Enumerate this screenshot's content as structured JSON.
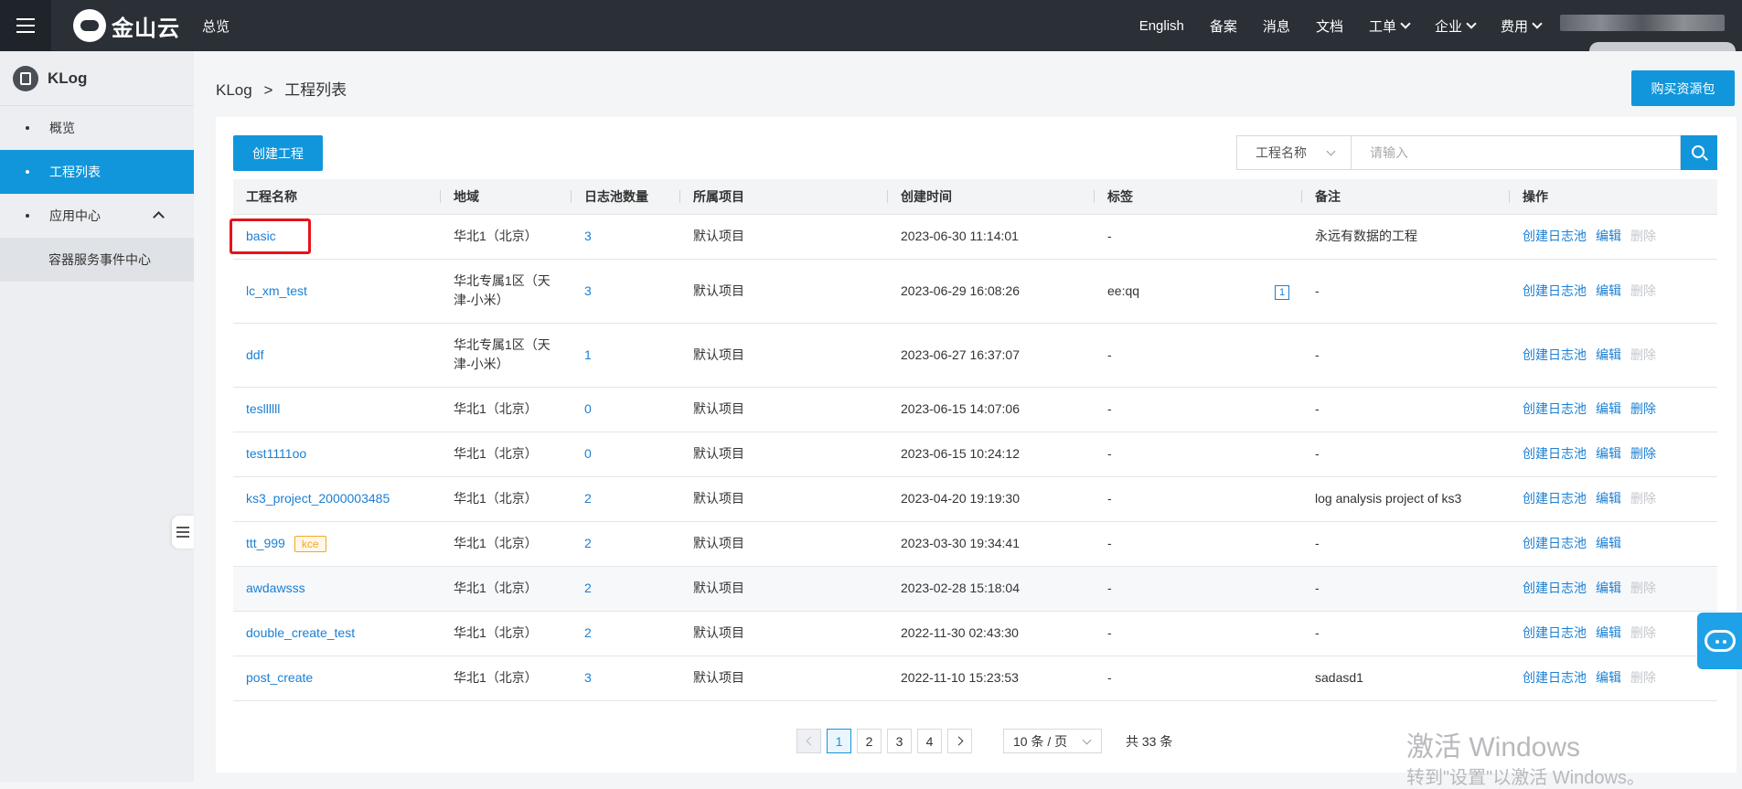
{
  "header": {
    "logo_text": "金山云",
    "overview": "总览",
    "nav": [
      "English",
      "备案",
      "消息",
      "文档"
    ],
    "dropdowns": [
      "工单",
      "企业",
      "费用"
    ]
  },
  "sidebar": {
    "product": "KLog",
    "items": [
      {
        "label": "概览"
      },
      {
        "label": "工程列表"
      },
      {
        "label": "应用中心"
      }
    ],
    "sub_item": "容器服务事件中心"
  },
  "breadcrumb": {
    "root": "KLog",
    "sep": ">",
    "current": "工程列表"
  },
  "toolbar": {
    "buy_label": "购买资源包",
    "create_label": "创建工程",
    "filter_selected": "工程名称",
    "search_placeholder": "请输入"
  },
  "table": {
    "columns": [
      "工程名称",
      "地域",
      "日志池数量",
      "所属项目",
      "创建时间",
      "标签",
      "备注",
      "操作"
    ],
    "actions": {
      "create_pool": "创建日志池",
      "edit": "编辑",
      "delete": "删除"
    },
    "rows": [
      {
        "name": "basic",
        "region": "华北1（北京）",
        "pools": "3",
        "project": "默认项目",
        "created": "2023-06-30 11:14:01",
        "tag": "-",
        "tag_count": "",
        "badge": "",
        "note": "永远有数据的工程",
        "delete_enabled": false,
        "show_delete": true
      },
      {
        "name": "lc_xm_test",
        "region": "华北专属1区（天津-小米）",
        "pools": "3",
        "project": "默认项目",
        "created": "2023-06-29 16:08:26",
        "tag": "ee:qq",
        "tag_count": "1",
        "badge": "",
        "note": "-",
        "delete_enabled": false,
        "show_delete": true
      },
      {
        "name": "ddf",
        "region": "华北专属1区（天津-小米）",
        "pools": "1",
        "project": "默认项目",
        "created": "2023-06-27 16:37:07",
        "tag": "-",
        "tag_count": "",
        "badge": "",
        "note": "-",
        "delete_enabled": false,
        "show_delete": true
      },
      {
        "name": "tesllllll",
        "region": "华北1（北京）",
        "pools": "0",
        "project": "默认项目",
        "created": "2023-06-15 14:07:06",
        "tag": "-",
        "tag_count": "",
        "badge": "",
        "note": "-",
        "delete_enabled": true,
        "show_delete": true
      },
      {
        "name": "test1111oo",
        "region": "华北1（北京）",
        "pools": "0",
        "project": "默认项目",
        "created": "2023-06-15 10:24:12",
        "tag": "-",
        "tag_count": "",
        "badge": "",
        "note": "-",
        "delete_enabled": true,
        "show_delete": true
      },
      {
        "name": "ks3_project_2000003485",
        "region": "华北1（北京）",
        "pools": "2",
        "project": "默认项目",
        "created": "2023-04-20 19:19:30",
        "tag": "-",
        "tag_count": "",
        "badge": "",
        "note": "log analysis project of ks3",
        "delete_enabled": false,
        "show_delete": true
      },
      {
        "name": "ttt_999",
        "region": "华北1（北京）",
        "pools": "2",
        "project": "默认项目",
        "created": "2023-03-30 19:34:41",
        "tag": "-",
        "tag_count": "",
        "badge": "kce",
        "note": "-",
        "delete_enabled": false,
        "show_delete": false
      },
      {
        "name": "awdawsss",
        "region": "华北1（北京）",
        "pools": "2",
        "project": "默认项目",
        "created": "2023-02-28 15:18:04",
        "tag": "-",
        "tag_count": "",
        "badge": "",
        "note": "-",
        "delete_enabled": false,
        "show_delete": true
      },
      {
        "name": "double_create_test",
        "region": "华北1（北京）",
        "pools": "2",
        "project": "默认项目",
        "created": "2022-11-30 02:43:30",
        "tag": "-",
        "tag_count": "",
        "badge": "",
        "note": "-",
        "delete_enabled": false,
        "show_delete": true
      },
      {
        "name": "post_create",
        "region": "华北1（北京）",
        "pools": "3",
        "project": "默认项目",
        "created": "2022-11-10 15:23:53",
        "tag": "-",
        "tag_count": "",
        "badge": "",
        "note": "sadasd1",
        "delete_enabled": false,
        "show_delete": true
      }
    ]
  },
  "pagination": {
    "pages": [
      "1",
      "2",
      "3",
      "4"
    ],
    "current_page": 1,
    "page_size": "10 条 / 页",
    "total": "共 33 条"
  },
  "watermark": {
    "line1": "激活 Windows",
    "line2": "转到\"设置\"以激活 Windows。"
  },
  "colors": {
    "accent": "#1296db",
    "topbar": "#2b2f36",
    "link": "#1a7fd4",
    "highlight_box": "#e5141a"
  }
}
